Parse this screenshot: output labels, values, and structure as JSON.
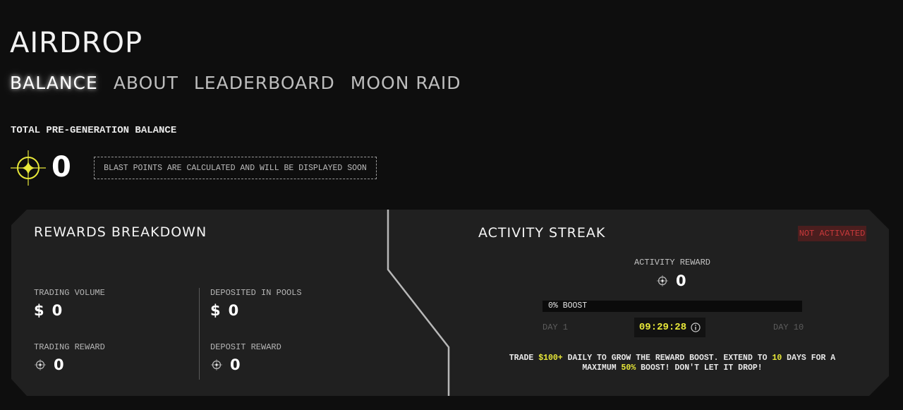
{
  "page": {
    "title": "AIRDROP"
  },
  "tabs": [
    {
      "label": "BALANCE",
      "active": true
    },
    {
      "label": "ABOUT",
      "active": false
    },
    {
      "label": "LEADERBOARD",
      "active": false
    },
    {
      "label": "MOON RAID",
      "active": false
    }
  ],
  "balance": {
    "label": "TOTAL PRE-GENERATION BALANCE",
    "icon": "blast-points-icon",
    "value": "0",
    "note": "BLAST POINTS ARE CALCULATED AND WILL BE DISPLAYED SOON"
  },
  "rewards": {
    "title": "REWARDS BREAKDOWN",
    "trading_volume": {
      "label": "TRADING VOLUME",
      "currency": "$",
      "value": "0"
    },
    "deposited": {
      "label": "DEPOSITED IN POOLS",
      "currency": "$",
      "value": "0"
    },
    "trading_reward": {
      "label": "TRADING REWARD",
      "icon": "points-icon",
      "value": "0"
    },
    "deposit_reward": {
      "label": "DEPOSIT REWARD",
      "icon": "points-icon",
      "value": "0"
    }
  },
  "streak": {
    "title": "ACTIVITY STREAK",
    "status": "NOT ACTIVATED",
    "activity_reward_label": "ACTIVITY REWARD",
    "activity_reward_value": "0",
    "boost_label": "0% BOOST",
    "boost_progress": 0,
    "day_start": "DAY 1",
    "day_end": "DAY 10",
    "timer": "09:29:28",
    "note": {
      "p1": "TRADE ",
      "h1": "$100+",
      "p2": " DAILY TO GROW THE REWARD BOOST. EXTEND TO ",
      "h2": "10",
      "p3": " DAYS FOR A MAXIMUM ",
      "h3": "50%",
      "p4": " BOOST! DON'T LET IT DROP!"
    }
  },
  "colors": {
    "accent": "#e8e839",
    "panel": "#202020",
    "background": "#0e0e0e",
    "status_bg": "#4a1e1e",
    "status_text": "#c8393b"
  }
}
